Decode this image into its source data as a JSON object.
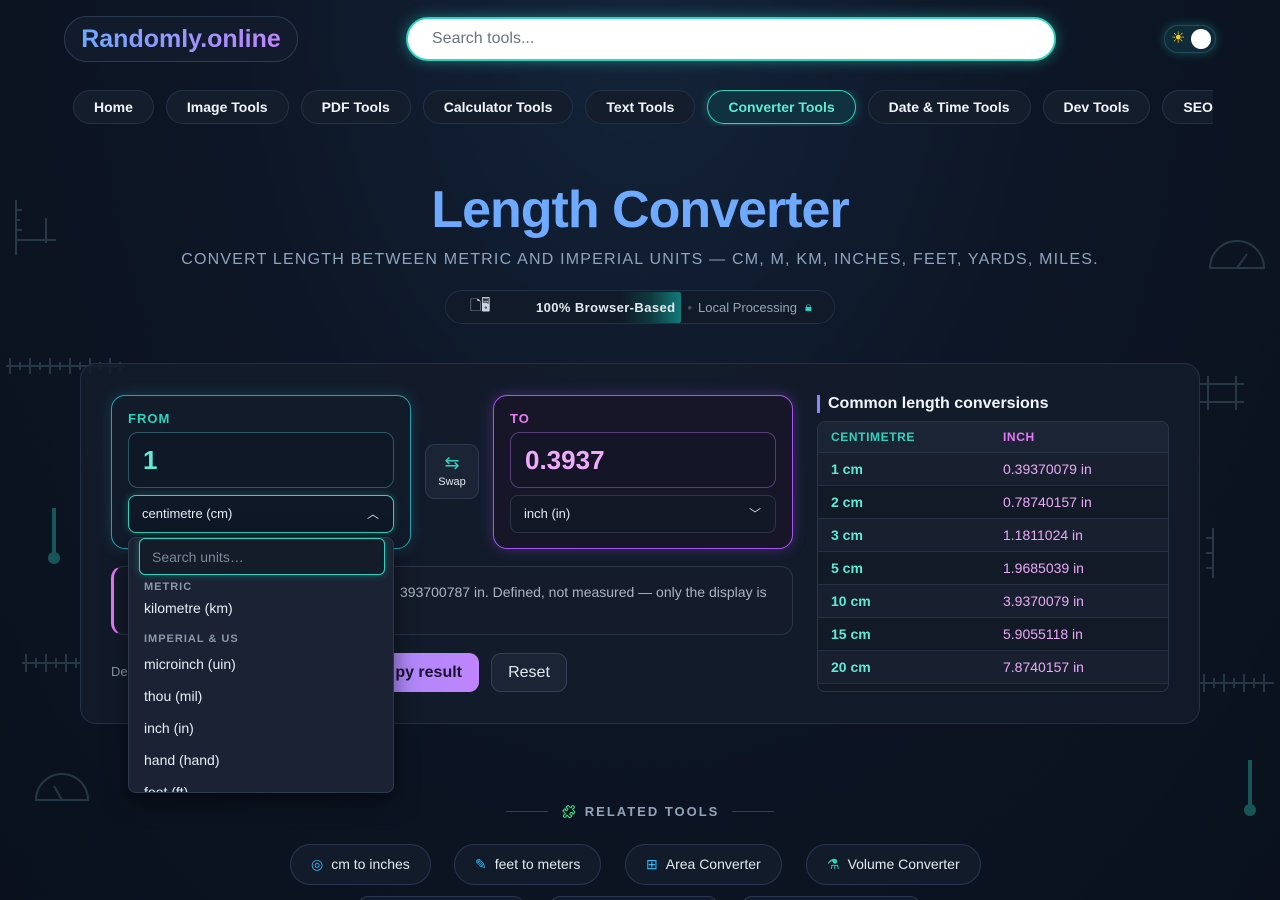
{
  "header": {
    "logo": "Randomly.online",
    "search_placeholder": "Search tools...",
    "theme_toggle_icon": "sun-icon"
  },
  "nav": {
    "items": [
      "Home",
      "Image Tools",
      "PDF Tools",
      "Calculator Tools",
      "Text Tools",
      "Converter Tools",
      "Date & Time Tools",
      "Dev Tools",
      "SEO"
    ],
    "active": "Converter Tools"
  },
  "hero": {
    "title": "Length Converter",
    "subtitle": "CONVERT LENGTH BETWEEN METRIC AND IMPERIAL UNITS — CM, M, KM, INCHES, FEET, YARDS, MILES.",
    "badge_main": "100% Browser-Based",
    "badge_secondary": "Local Processing"
  },
  "converter": {
    "from_label": "FROM",
    "from_value": "1",
    "from_unit": "centimetre (cm)",
    "to_label": "TO",
    "to_value": "0.3937",
    "to_unit": "inch (in)",
    "swap_label": "Swap",
    "note_visible": "393700787 in. Defined, not measured — only the display is",
    "def_prefix": "De",
    "copy_label": "py result",
    "reset_label": "Reset"
  },
  "dropdown": {
    "search_placeholder": "Search units…",
    "groups": [
      {
        "label": "METRIC",
        "options": [
          "kilometre (km)"
        ]
      },
      {
        "label": "IMPERIAL & US",
        "options": [
          "microinch (uin)",
          "thou (mil)",
          "inch (in)",
          "hand (hand)",
          "foot (ft)"
        ]
      }
    ]
  },
  "table": {
    "title": "Common length conversions",
    "headers": [
      "CENTIMETRE",
      "INCH"
    ],
    "rows": [
      [
        "1 cm",
        "0.39370079 in"
      ],
      [
        "2 cm",
        "0.78740157 in"
      ],
      [
        "3 cm",
        "1.1811024 in"
      ],
      [
        "5 cm",
        "1.9685039 in"
      ],
      [
        "10 cm",
        "3.9370079 in"
      ],
      [
        "15 cm",
        "5.9055118 in"
      ],
      [
        "20 cm",
        "7.8740157 in"
      ]
    ]
  },
  "related": {
    "title": "RELATED TOOLS",
    "items": [
      {
        "label": "cm to inches",
        "icon": "tape-measure-icon"
      },
      {
        "label": "feet to meters",
        "icon": "ruler-icon"
      },
      {
        "label": "Area Converter",
        "icon": "grid-icon"
      },
      {
        "label": "Volume Converter",
        "icon": "flask-icon"
      }
    ]
  }
}
